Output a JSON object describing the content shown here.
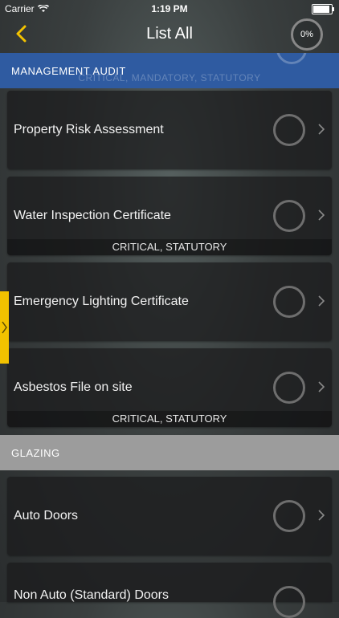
{
  "status": {
    "carrier": "Carrier",
    "time": "1:19 PM"
  },
  "nav": {
    "title": "List All",
    "progress": "0%"
  },
  "sections": [
    {
      "label": "MANAGEMENT AUDIT",
      "ghost_tags": "CRITICAL, MANDATORY, STATUTORY",
      "items": [
        {
          "title": "Property Risk Assessment",
          "tags": ""
        },
        {
          "title": "Water Inspection Certificate",
          "tags": "CRITICAL, STATUTORY"
        },
        {
          "title": "Emergency Lighting Certificate",
          "tags": ""
        },
        {
          "title": "Asbestos File on site",
          "tags": "CRITICAL, STATUTORY"
        }
      ]
    },
    {
      "label": "GLAZING",
      "items": [
        {
          "title": "Auto Doors",
          "tags": ""
        },
        {
          "title": "Non Auto (Standard) Doors",
          "tags": ""
        }
      ]
    }
  ],
  "colors": {
    "section_active": "#2f5ba1",
    "section_inactive": "#9c9c9c",
    "accent": "#f2c200"
  }
}
